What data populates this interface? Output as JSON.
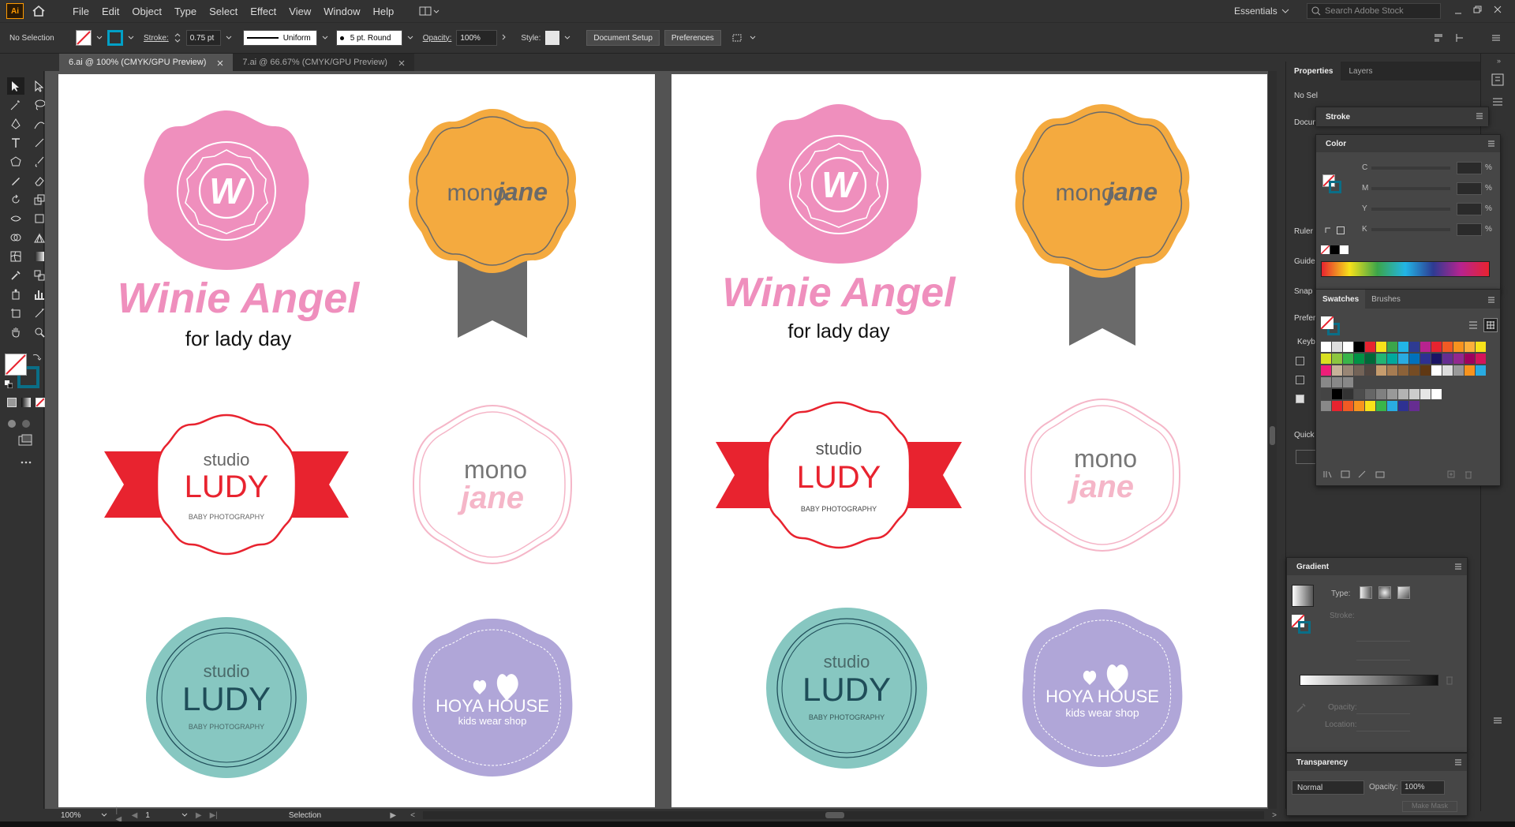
{
  "app": {
    "logo": "Ai",
    "workspace": "Essentials",
    "search_placeholder": "Search Adobe Stock"
  },
  "menu": [
    "File",
    "Edit",
    "Object",
    "Type",
    "Select",
    "Effect",
    "View",
    "Window",
    "Help"
  ],
  "control_bar": {
    "selection": "No Selection",
    "stroke_label": "Stroke:",
    "stroke_value": "0.75 pt",
    "stroke_style": "Uniform",
    "brush": "5 pt. Round",
    "opacity_label": "Opacity:",
    "opacity_value": "100%",
    "style_label": "Style:",
    "doc_setup": "Document Setup",
    "preferences": "Preferences"
  },
  "tabs": [
    {
      "label": "6.ai @ 100% (CMYK/GPU Preview)",
      "active": true
    },
    {
      "label": "7.ai @ 66.67% (CMYK/GPU Preview)",
      "active": false
    }
  ],
  "logos": {
    "winie": {
      "title": "Winie Angel",
      "sub": "for lady day",
      "letter": "W"
    },
    "mono": {
      "a": "mono",
      "b": "jane"
    },
    "ludy": {
      "studio": "studio",
      "name": "LUDY",
      "sub": "BABY PHOTOGRAPHY"
    },
    "hoya": {
      "title": "HOYA HOUSE",
      "sub": "kids wear shop"
    }
  },
  "status": {
    "zoom": "100%",
    "page": "1",
    "tool": "Selection"
  },
  "props_panel": {
    "tabs": [
      "Properties",
      "Layers"
    ],
    "no_selection": "No Sel",
    "labels": [
      "Docum",
      "Ruler",
      "Guide",
      "Snap",
      "Prefer",
      "Keyb",
      "Quick"
    ]
  },
  "stroke_panel": {
    "title": "Stroke"
  },
  "color_panel": {
    "title": "Color",
    "channels": [
      "C",
      "M",
      "Y",
      "K"
    ],
    "unit": "%"
  },
  "swatches_panel": {
    "tabs": [
      "Swatches",
      "Brushes"
    ]
  },
  "gradient_panel": {
    "title": "Gradient",
    "type_label": "Type:",
    "stroke_label": "Stroke:",
    "opacity_label": "Opacity:",
    "location_label": "Location:"
  },
  "transparency_panel": {
    "title": "Transparency",
    "mode": "Normal",
    "opacity_label": "Opacity:",
    "opacity_value": "100%",
    "mask_button": "Make Mask"
  },
  "colors": {
    "pink": "#ef8fbd",
    "orange": "#f4aa3f",
    "red": "#e8232f",
    "teal": "#87c7c1",
    "purple": "#b0a6d8"
  }
}
